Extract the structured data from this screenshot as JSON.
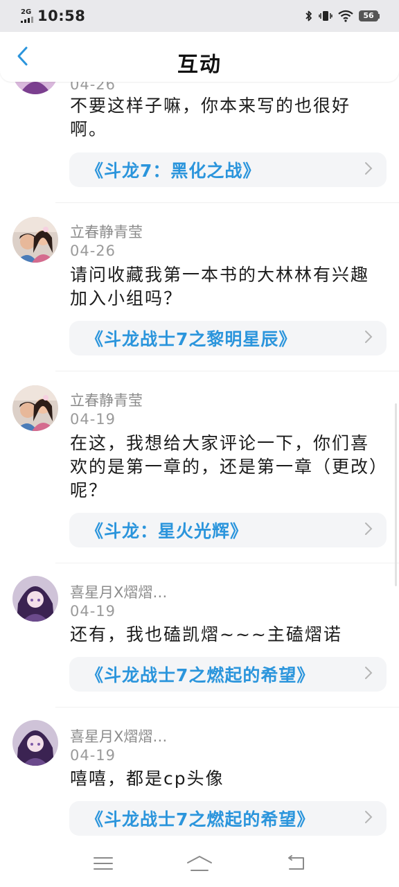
{
  "status_bar": {
    "network": "2G",
    "time": "10:58",
    "battery": "56"
  },
  "header": {
    "title": "互动"
  },
  "items": [
    {
      "user": "",
      "date": "04-26",
      "comment": "不要这样子嘛，你本来写的也很好啊。",
      "book": "《斗龙7：黑化之战》"
    },
    {
      "user": "立春静青莹",
      "date": "04-26",
      "comment": "请问收藏我第一本书的大林林有兴趣加入小组吗？",
      "book": "《斗龙战士7之黎明星辰》"
    },
    {
      "user": "立春静青莹",
      "date": "04-19",
      "comment": "在这，我想给大家评论一下，你们喜欢的是第一章的，还是第一章（更改）呢？",
      "book": "《斗龙：星火光辉》"
    },
    {
      "user": "喜星月X熠熠…",
      "date": "04-19",
      "comment": "还有，我也磕凯熠~~~主磕熠诺",
      "book": "《斗龙战士7之燃起的希望》"
    },
    {
      "user": "喜星月X熠熠…",
      "date": "04-19",
      "comment": "嘻嘻，都是cp头像",
      "book": "《斗龙战士7之燃起的希望》"
    }
  ],
  "icons": {
    "back": "chevron-left-icon",
    "card_arrow": "chevron-right-icon",
    "nav": [
      "menu-icon",
      "home-icon",
      "back-icon"
    ]
  },
  "colors": {
    "accent": "#2b95dc",
    "card_bg": "#f4f5f7",
    "status_bg": "#e9e9ec"
  }
}
